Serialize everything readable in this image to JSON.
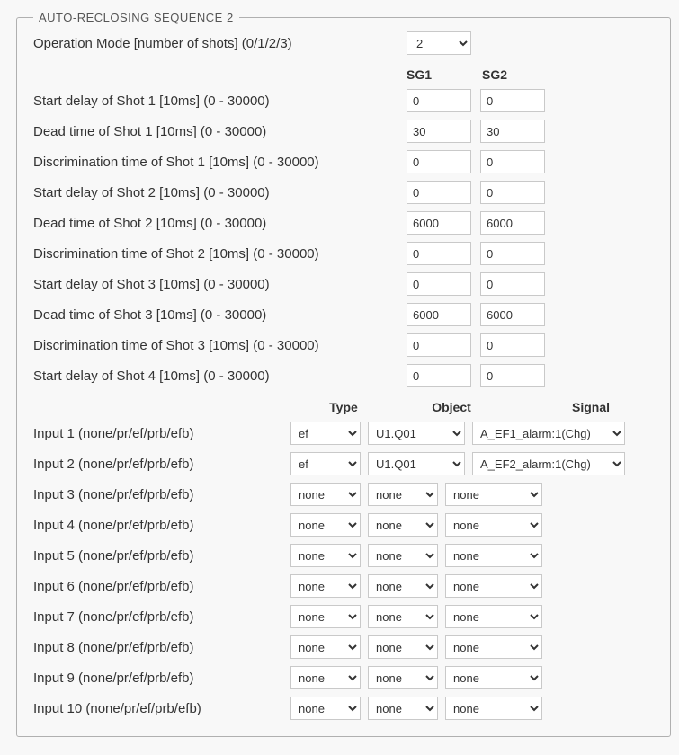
{
  "fieldset_title": "AUTO-RECLOSING SEQUENCE 2",
  "op_mode": {
    "label": "Operation Mode [number of shots] (0/1/2/3)",
    "value": "2"
  },
  "sg_headers": [
    "SG1",
    "SG2"
  ],
  "shots": [
    {
      "label": "Start delay of Shot 1 [10ms] (0 - 30000)",
      "sg1": "0",
      "sg2": "0"
    },
    {
      "label": "Dead time of Shot 1 [10ms] (0 - 30000)",
      "sg1": "30",
      "sg2": "30"
    },
    {
      "label": "Discrimination time of Shot 1 [10ms] (0 - 30000)",
      "sg1": "0",
      "sg2": "0"
    },
    {
      "label": "Start delay of Shot 2 [10ms] (0 - 30000)",
      "sg1": "0",
      "sg2": "0"
    },
    {
      "label": "Dead time of Shot 2 [10ms] (0 - 30000)",
      "sg1": "6000",
      "sg2": "6000"
    },
    {
      "label": "Discrimination time of Shot 2 [10ms] (0 - 30000)",
      "sg1": "0",
      "sg2": "0"
    },
    {
      "label": "Start delay of Shot 3 [10ms] (0 - 30000)",
      "sg1": "0",
      "sg2": "0"
    },
    {
      "label": "Dead time of Shot 3 [10ms] (0 - 30000)",
      "sg1": "6000",
      "sg2": "6000"
    },
    {
      "label": "Discrimination time of Shot 3 [10ms] (0 - 30000)",
      "sg1": "0",
      "sg2": "0"
    },
    {
      "label": "Start delay of Shot 4 [10ms] (0 - 30000)",
      "sg1": "0",
      "sg2": "0"
    }
  ],
  "io_headers": {
    "type": "Type",
    "object": "Object",
    "signal": "Signal"
  },
  "inputs": [
    {
      "label": "Input 1 (none/pr/ef/prb/efb)",
      "type": "ef",
      "object": "U1.Q01",
      "signal": "A_EF1_alarm:1(Chg)",
      "wide": true
    },
    {
      "label": "Input 2 (none/pr/ef/prb/efb)",
      "type": "ef",
      "object": "U1.Q01",
      "signal": "A_EF2_alarm:1(Chg)",
      "wide": true
    },
    {
      "label": "Input 3 (none/pr/ef/prb/efb)",
      "type": "none",
      "object": "none",
      "signal": "none"
    },
    {
      "label": "Input 4 (none/pr/ef/prb/efb)",
      "type": "none",
      "object": "none",
      "signal": "none"
    },
    {
      "label": "Input 5 (none/pr/ef/prb/efb)",
      "type": "none",
      "object": "none",
      "signal": "none"
    },
    {
      "label": "Input 6 (none/pr/ef/prb/efb)",
      "type": "none",
      "object": "none",
      "signal": "none"
    },
    {
      "label": "Input 7 (none/pr/ef/prb/efb)",
      "type": "none",
      "object": "none",
      "signal": "none"
    },
    {
      "label": "Input 8 (none/pr/ef/prb/efb)",
      "type": "none",
      "object": "none",
      "signal": "none"
    },
    {
      "label": "Input 9 (none/pr/ef/prb/efb)",
      "type": "none",
      "object": "none",
      "signal": "none"
    },
    {
      "label": "Input 10 (none/pr/ef/prb/efb)",
      "type": "none",
      "object": "none",
      "signal": "none"
    }
  ]
}
